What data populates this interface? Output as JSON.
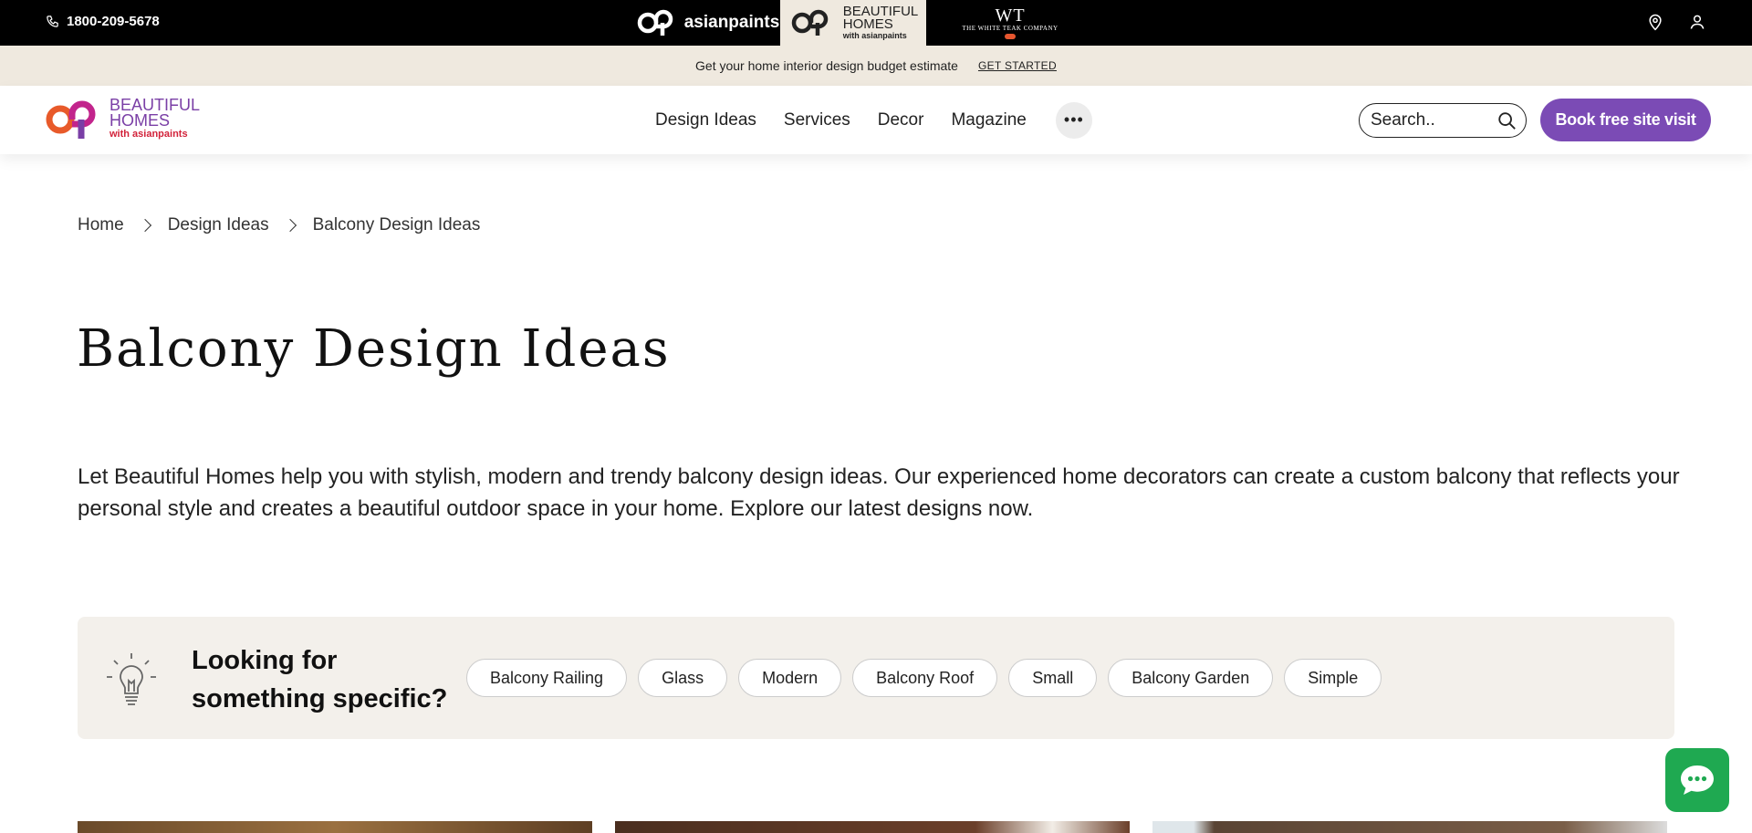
{
  "topbar": {
    "phone": "1800-209-5678",
    "brands": {
      "asianpaints": "asianpaints",
      "beautiful_homes_line1": "BEAUTIFUL",
      "beautiful_homes_line2": "HOMES",
      "beautiful_homes_sub": "with asianpaints",
      "white_teak_mono": "WT",
      "white_teak_name": "THE WHITE TEAK COMPANY"
    },
    "icons": [
      "phone-icon",
      "location-pin-icon",
      "user-icon"
    ]
  },
  "promo": {
    "text": "Get your home interior design budget estimate",
    "cta": "GET STARTED"
  },
  "header": {
    "logo_line1": "BEAUTIFUL",
    "logo_line2": "HOMES",
    "logo_sub": "with asianpaints",
    "nav": [
      "Design Ideas",
      "Services",
      "Decor",
      "Magazine"
    ],
    "more_label": "•••",
    "search_placeholder": "Search..",
    "book_label": "Book free site visit",
    "accent": "#7b4bb5"
  },
  "breadcrumb": [
    "Home",
    "Design Ideas",
    "Balcony Design Ideas"
  ],
  "page": {
    "title": "Balcony Design Ideas",
    "intro": "Let Beautiful Homes help you with stylish, modern and trendy balcony design ideas. Our experienced home decorators can create a custom balcony that reflects your personal style and creates a beautiful outdoor space in your home. Explore our latest designs now."
  },
  "finder": {
    "question_line1": "Looking for",
    "question_line2": "something specific?",
    "chips": [
      "Balcony Railing",
      "Glass",
      "Modern",
      "Balcony Roof",
      "Small",
      "Balcony Garden",
      "Simple"
    ]
  },
  "chat": {
    "color": "#1fa951",
    "icon": "chat-bubble-icon"
  }
}
